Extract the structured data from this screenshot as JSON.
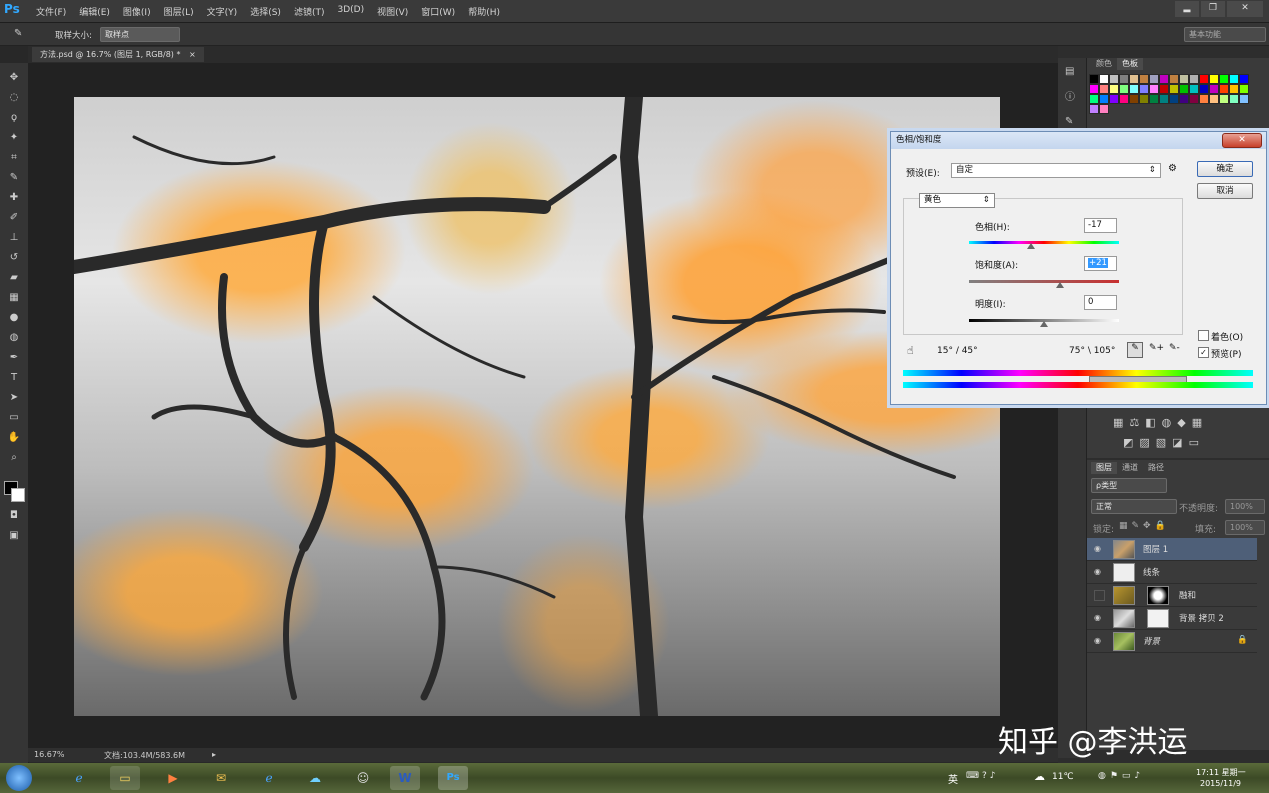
{
  "app": {
    "logo": "Ps"
  },
  "menu": [
    "文件(F)",
    "编辑(E)",
    "图像(I)",
    "图层(L)",
    "文字(Y)",
    "选择(S)",
    "滤镜(T)",
    "3D(D)",
    "视图(V)",
    "窗口(W)",
    "帮助(H)"
  ],
  "window_controls": [
    "▂",
    "❐",
    "✕"
  ],
  "options": {
    "sample_size_label": "取样大小:",
    "sample_size_value": "取样点",
    "workspace": "基本功能"
  },
  "document": {
    "tab_title": "方法.psd @ 16.7% (图层 1, RGB/8) *",
    "tab_close": "×"
  },
  "status": {
    "zoom": "16.67%",
    "doc_info": "文档:103.4M/583.6M"
  },
  "swatches_panel": {
    "tabs": [
      "颜色",
      "色板"
    ],
    "colors": [
      "#000000",
      "#ffffff",
      "#c0c0c0",
      "#808080",
      "#e0c090",
      "#c08040",
      "#a0a0c0",
      "#c000c0",
      "#c08040",
      "#c0c0a0",
      "#b0b0b0",
      "#ff0000",
      "#ffff00",
      "#00ff00",
      "#00ffff",
      "#0000ff",
      "#ff00ff",
      "#ff8080",
      "#ffff80",
      "#80ff80",
      "#80ffff",
      "#8080ff",
      "#ff80ff",
      "#c00000",
      "#c0c000",
      "#00c000",
      "#00c0c0",
      "#0000c0",
      "#c000c0",
      "#ff4000",
      "#ffc000",
      "#80ff00",
      "#00ff80",
      "#0080ff",
      "#8000ff",
      "#ff0080",
      "#804000",
      "#808000",
      "#008040",
      "#008080",
      "#004080",
      "#400080",
      "#800040",
      "#ff8040",
      "#ffc080",
      "#c0ff80",
      "#80ffc0",
      "#80c0ff",
      "#c080ff",
      "#ff80c0"
    ]
  },
  "dialog": {
    "title": "色相/饱和度",
    "close": "✕",
    "preset_label": "预设(E):",
    "preset_value": "自定",
    "ok": "确定",
    "cancel": "取消",
    "channel": "黄色",
    "hue_label": "色相(H):",
    "hue_value": "-17",
    "sat_label": "饱和度(A):",
    "sat_value": "+21",
    "light_label": "明度(I):",
    "light_value": "0",
    "range_left": "15° / 45°",
    "range_right": "75° \\ 105°",
    "colorize_label": "着色(O)",
    "preview_label": "预览(P)"
  },
  "layers_panel": {
    "tabs": [
      "图层",
      "通道",
      "路径"
    ],
    "filter": "ρ类型",
    "blend_mode": "正常",
    "opacity_label": "不透明度:",
    "opacity_value": "100%",
    "lock_label": "锁定:",
    "fill_label": "填充:",
    "fill_value": "100%",
    "layers": [
      {
        "name": "图层 1",
        "selected": true,
        "visible": true
      },
      {
        "name": "线条",
        "selected": false,
        "visible": true
      },
      {
        "name": "融和",
        "selected": false,
        "visible": false
      },
      {
        "name": "背景 拷贝 2",
        "selected": false,
        "visible": true
      },
      {
        "name": "背景",
        "selected": false,
        "visible": true
      }
    ]
  },
  "taskbar": {
    "ime": "英",
    "weather": "11℃",
    "time": "17:11 星期一",
    "date": "2015/11/9"
  },
  "watermark": "知乎 @李洪运"
}
